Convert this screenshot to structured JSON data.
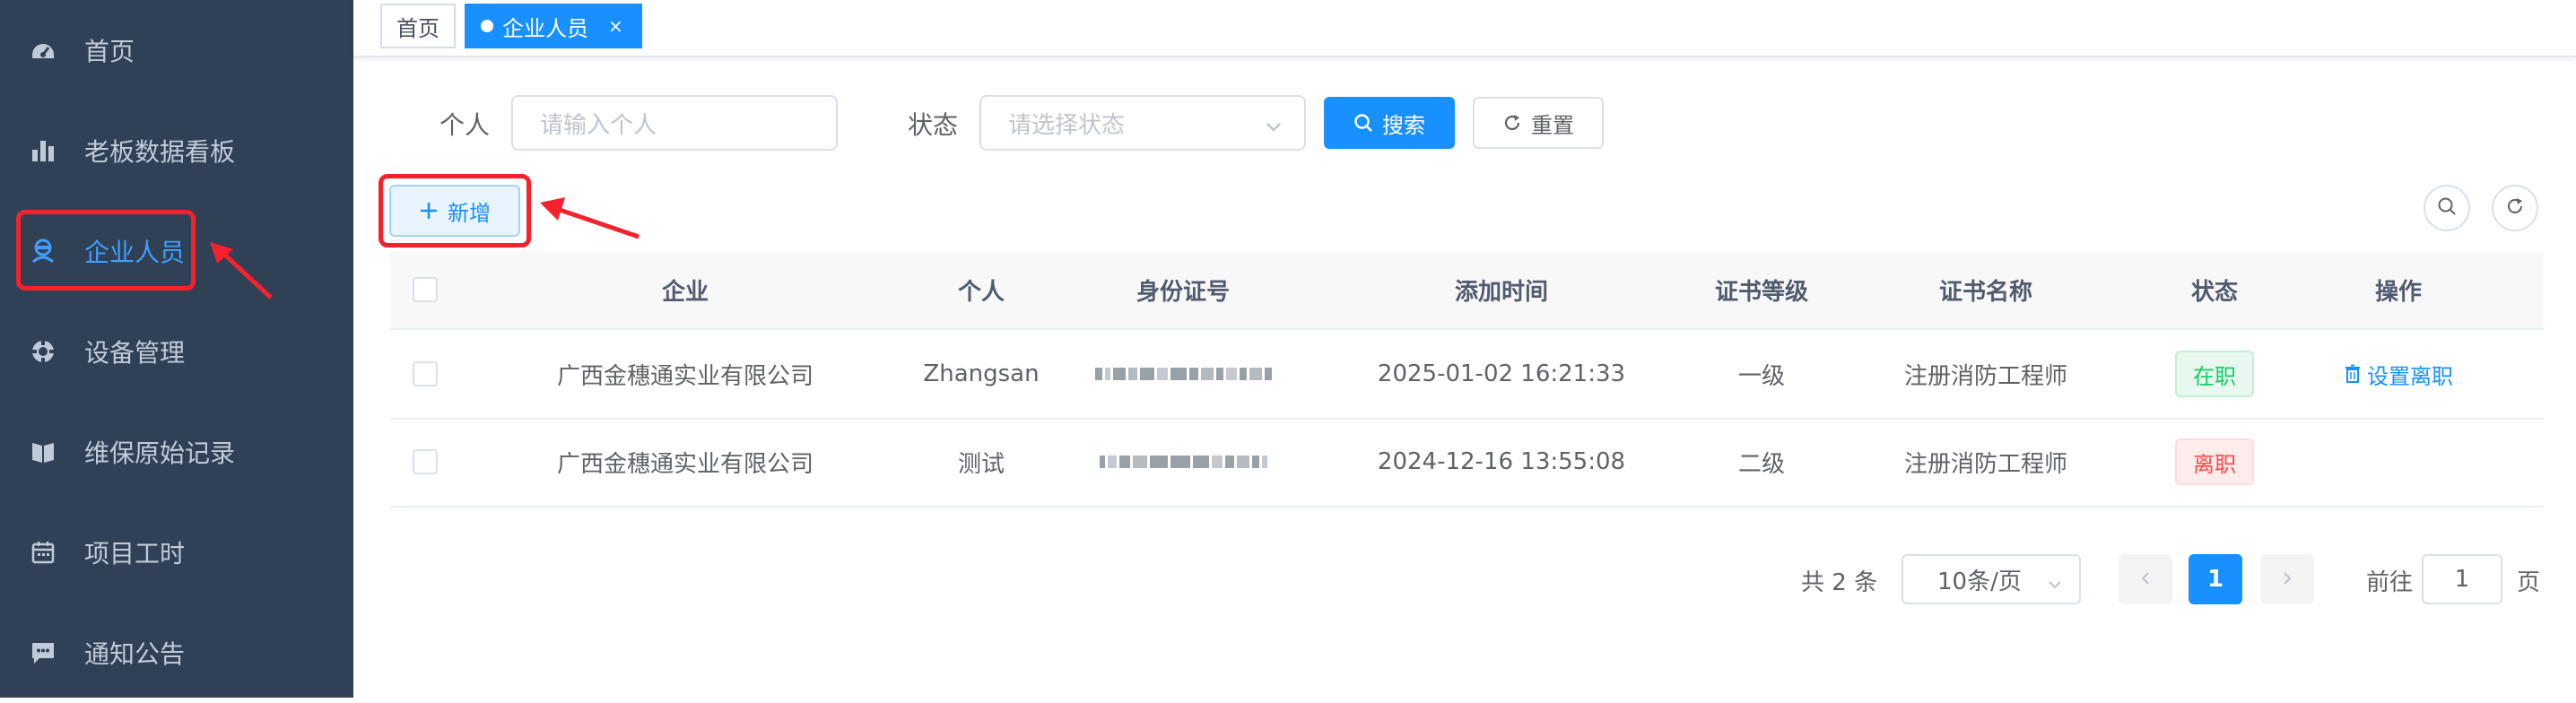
{
  "sidebar": {
    "items": [
      {
        "label": "首页",
        "icon": "dashboard-icon"
      },
      {
        "label": "老板数据看板",
        "icon": "bar-chart-icon"
      },
      {
        "label": "企业人员",
        "icon": "people-icon"
      },
      {
        "label": "设备管理",
        "icon": "settings-icon"
      },
      {
        "label": "维保原始记录",
        "icon": "book-icon"
      },
      {
        "label": "项目工时",
        "icon": "calendar-icon"
      },
      {
        "label": "通知公告",
        "icon": "message-icon"
      }
    ],
    "active_index": 2
  },
  "tags": {
    "home": "首页",
    "active": "企业人员",
    "close": "×"
  },
  "search": {
    "person_label": "个人",
    "person_placeholder": "请输入个人",
    "status_label": "状态",
    "status_placeholder": "请选择状态",
    "search_button": "搜索",
    "reset_button": "重置"
  },
  "toolbar": {
    "add_button": "新增"
  },
  "table": {
    "headers": [
      "企业",
      "个人",
      "身份证号",
      "添加时间",
      "证书等级",
      "证书名称",
      "状态",
      "操作"
    ],
    "rows": [
      {
        "company": "广西金穗通实业有限公司",
        "person": "Zhangsan",
        "id_number": "",
        "added_time": "2025-01-02 16:21:33",
        "cert_level": "一级",
        "cert_name": "注册消防工程师",
        "status": "在职",
        "action": "设置离职"
      },
      {
        "company": "广西金穗通实业有限公司",
        "person": "测试",
        "id_number": "",
        "added_time": "2024-12-16 13:55:08",
        "cert_level": "二级",
        "cert_name": "注册消防工程师",
        "status": "离职",
        "action": ""
      }
    ]
  },
  "pagination": {
    "total": "共 2 条",
    "page_size": "10条/页",
    "current_page": "1",
    "goto_label": "前往",
    "goto_value": "1",
    "page_suffix": "页"
  },
  "colors": {
    "sidebar_bg": "#304156",
    "primary": "#1890ff",
    "annotation": "#f5222d"
  }
}
